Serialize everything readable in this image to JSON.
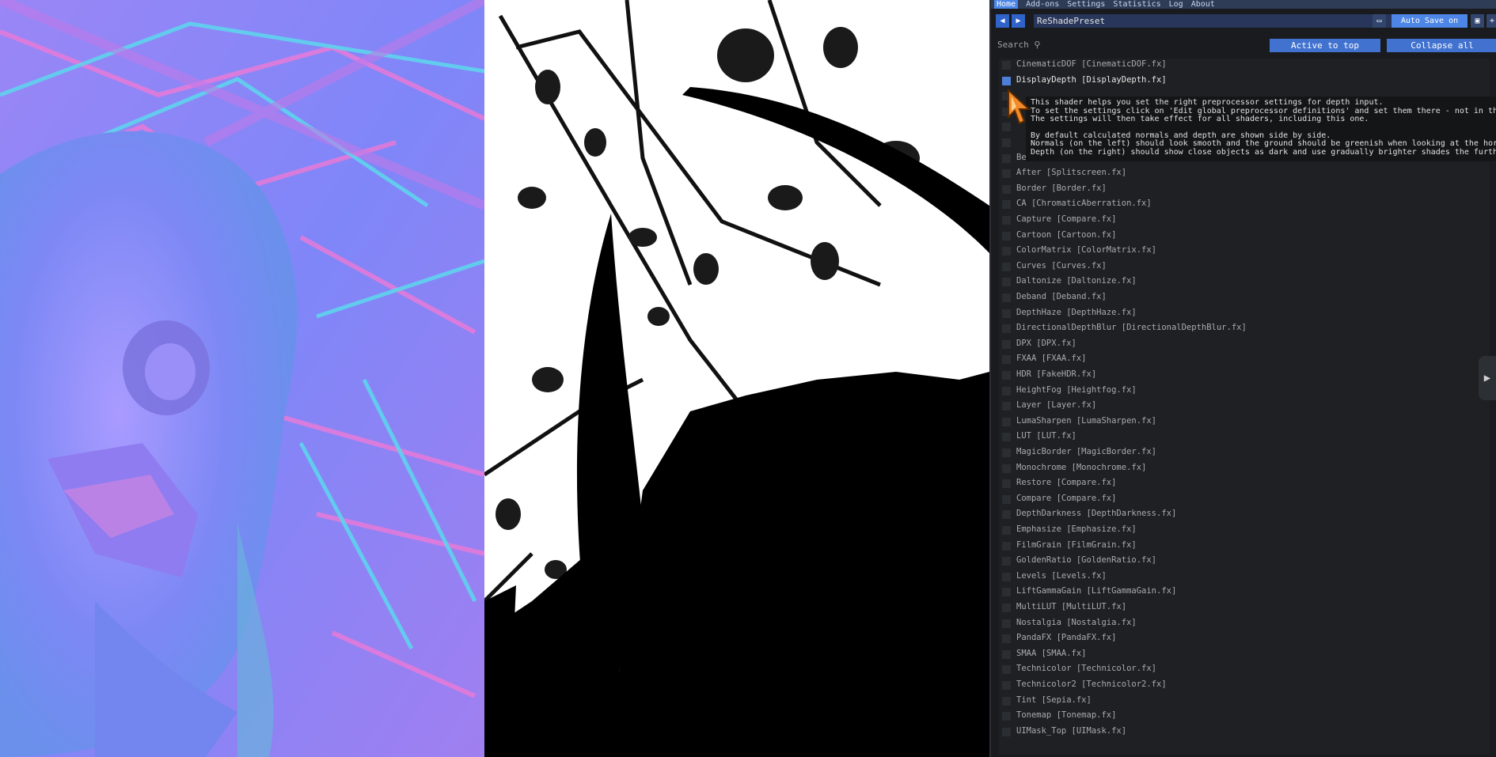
{
  "menu": [
    "Home",
    "Add-ons",
    "Settings",
    "Statistics",
    "Log",
    "About"
  ],
  "toolbar": {
    "prev_icon": "arrow-left-icon",
    "next_icon": "arrow-right-icon",
    "preset_name": "ReShadePreset",
    "folder_icon": "folder-icon",
    "auto_save_label": "Auto Save on",
    "save_icon": "save-icon",
    "add_icon": "plus-icon"
  },
  "search": {
    "label": "Search",
    "active_to_top_label": "Active to top",
    "collapse_all_label": "Collapse all"
  },
  "effects": [
    {
      "label": "CinematicDOF [CinematicDOF.fx]",
      "checked": false
    },
    {
      "label": "DisplayDepth [DisplayDepth.fx]",
      "checked": true
    },
    {
      "label": "",
      "checked": false
    },
    {
      "label": "",
      "checked": false
    },
    {
      "label": "",
      "checked": false
    },
    {
      "label": "",
      "checked": false
    },
    {
      "label": "Before [Splitscreen.fx]",
      "checked": false
    },
    {
      "label": "After [Splitscreen.fx]",
      "checked": false
    },
    {
      "label": "Border [Border.fx]",
      "checked": false
    },
    {
      "label": "CA [ChromaticAberration.fx]",
      "checked": false
    },
    {
      "label": "Capture [Compare.fx]",
      "checked": false
    },
    {
      "label": "Cartoon [Cartoon.fx]",
      "checked": false
    },
    {
      "label": "ColorMatrix [ColorMatrix.fx]",
      "checked": false
    },
    {
      "label": "Curves [Curves.fx]",
      "checked": false
    },
    {
      "label": "Daltonize [Daltonize.fx]",
      "checked": false
    },
    {
      "label": "Deband [Deband.fx]",
      "checked": false
    },
    {
      "label": "DepthHaze [DepthHaze.fx]",
      "checked": false
    },
    {
      "label": "DirectionalDepthBlur [DirectionalDepthBlur.fx]",
      "checked": false
    },
    {
      "label": "DPX [DPX.fx]",
      "checked": false
    },
    {
      "label": "FXAA [FXAA.fx]",
      "checked": false
    },
    {
      "label": "HDR [FakeHDR.fx]",
      "checked": false
    },
    {
      "label": "HeightFog [Heightfog.fx]",
      "checked": false
    },
    {
      "label": "Layer [Layer.fx]",
      "checked": false
    },
    {
      "label": "LumaSharpen [LumaSharpen.fx]",
      "checked": false
    },
    {
      "label": "LUT [LUT.fx]",
      "checked": false
    },
    {
      "label": "MagicBorder [MagicBorder.fx]",
      "checked": false
    },
    {
      "label": "Monochrome [Monochrome.fx]",
      "checked": false
    },
    {
      "label": "Restore [Compare.fx]",
      "checked": false
    },
    {
      "label": "Compare [Compare.fx]",
      "checked": false
    },
    {
      "label": "DepthDarkness [DepthDarkness.fx]",
      "checked": false
    },
    {
      "label": "Emphasize [Emphasize.fx]",
      "checked": false
    },
    {
      "label": "FilmGrain [FilmGrain.fx]",
      "checked": false
    },
    {
      "label": "GoldenRatio [GoldenRatio.fx]",
      "checked": false
    },
    {
      "label": "Levels [Levels.fx]",
      "checked": false
    },
    {
      "label": "LiftGammaGain [LiftGammaGain.fx]",
      "checked": false
    },
    {
      "label": "MultiLUT [MultiLUT.fx]",
      "checked": false
    },
    {
      "label": "Nostalgia [Nostalgia.fx]",
      "checked": false
    },
    {
      "label": "PandaFX [PandaFX.fx]",
      "checked": false
    },
    {
      "label": "SMAA [SMAA.fx]",
      "checked": false
    },
    {
      "label": "Technicolor [Technicolor.fx]",
      "checked": false
    },
    {
      "label": "Technicolor2 [Technicolor2.fx]",
      "checked": false
    },
    {
      "label": "Tint [Sepia.fx]",
      "checked": false
    },
    {
      "label": "Tonemap [Tonemap.fx]",
      "checked": false
    },
    {
      "label": "UIMask_Top [UIMask.fx]",
      "checked": false
    }
  ],
  "tooltip": {
    "line1": "This shader helps you set the right preprocessor settings for depth input.",
    "line2": "To set the settings click on 'Edit global preprocessor definitions' and set them there - not in thi",
    "line3": "The settings will then take effect for all shaders, including this one.",
    "line4": "By default calculated normals and depth are shown side by side.",
    "line5": "Normals (on the left) should look smooth and the ground should be greenish when looking at the hori",
    "line6": "Depth (on the right) should show close objects as dark and use gradually brighter shades the furthe"
  },
  "colors": {
    "accent": "#4272cf",
    "panel_bg": "#191b1e",
    "normal_map": "#8a7cf2",
    "depth_far": "#ffffff",
    "depth_near": "#000000"
  },
  "side_toggle_icon": "chevron-right-icon"
}
